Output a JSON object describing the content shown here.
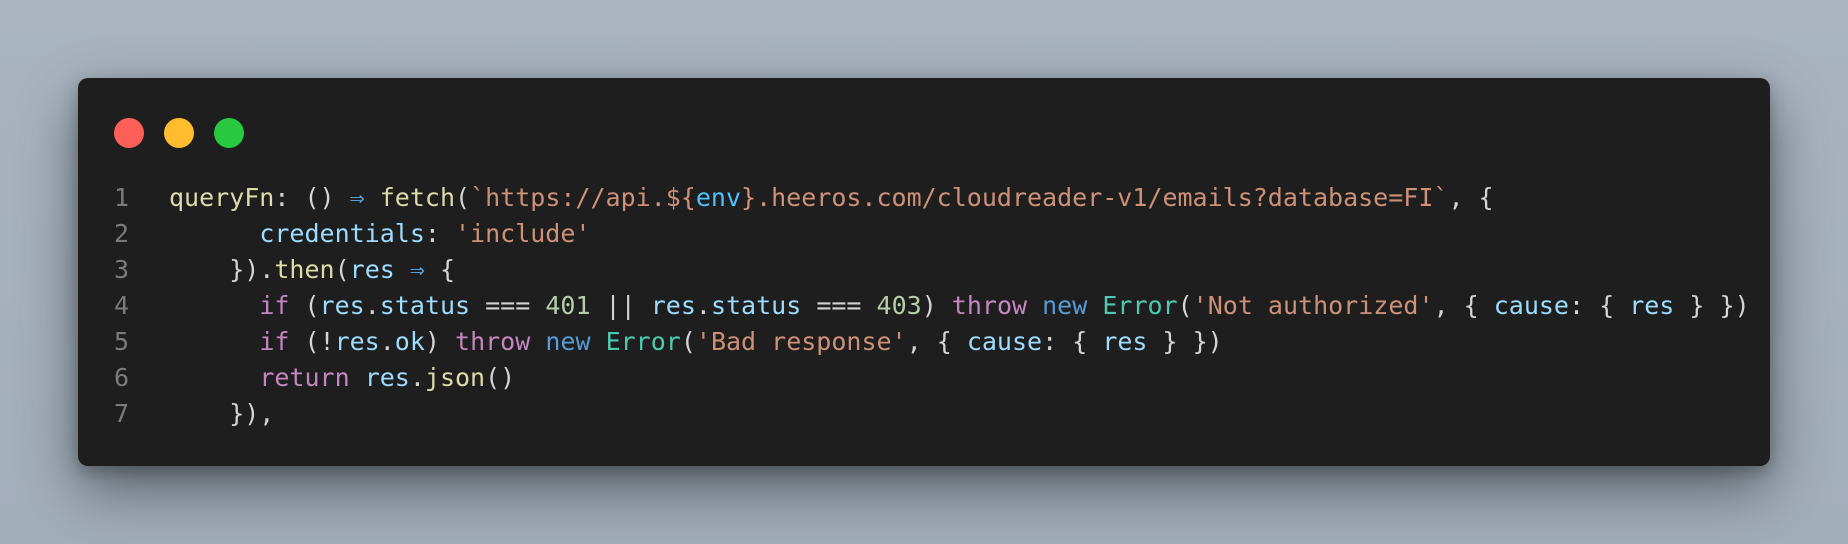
{
  "window": {
    "colors": {
      "background": "#1e1e1e",
      "close": "#ff5f57",
      "minimize": "#febc2e",
      "maximize": "#28c840"
    },
    "traffic_lights": [
      "close-button",
      "minimize-button",
      "maximize-button"
    ]
  },
  "code": {
    "language": "javascript",
    "lines": [
      {
        "number": "1",
        "tokens": [
          {
            "text": "queryFn",
            "color": "#dcdcaa"
          },
          {
            "text": ": () ",
            "color": "#d4d4d4"
          },
          {
            "text": "⇒",
            "color": "#569cd6"
          },
          {
            "text": " ",
            "color": "#d4d4d4"
          },
          {
            "text": "fetch",
            "color": "#dcdcaa"
          },
          {
            "text": "(",
            "color": "#d4d4d4"
          },
          {
            "text": "`https://api.${",
            "color": "#ce9178"
          },
          {
            "text": "env",
            "color": "#4fc1ff"
          },
          {
            "text": "}.heeros.com/cloudreader-v1/emails?database=FI`",
            "color": "#ce9178"
          },
          {
            "text": ", {",
            "color": "#d4d4d4"
          }
        ]
      },
      {
        "number": "2",
        "tokens": [
          {
            "text": "      ",
            "color": "#d4d4d4"
          },
          {
            "text": "credentials",
            "color": "#9cdcfe"
          },
          {
            "text": ": ",
            "color": "#d4d4d4"
          },
          {
            "text": "'include'",
            "color": "#ce9178"
          }
        ]
      },
      {
        "number": "3",
        "tokens": [
          {
            "text": "    }).",
            "color": "#d4d4d4"
          },
          {
            "text": "then",
            "color": "#dcdcaa"
          },
          {
            "text": "(",
            "color": "#d4d4d4"
          },
          {
            "text": "res",
            "color": "#9cdcfe"
          },
          {
            "text": " ",
            "color": "#d4d4d4"
          },
          {
            "text": "⇒",
            "color": "#569cd6"
          },
          {
            "text": " {",
            "color": "#d4d4d4"
          }
        ]
      },
      {
        "number": "4",
        "tokens": [
          {
            "text": "      ",
            "color": "#d4d4d4"
          },
          {
            "text": "if",
            "color": "#c586c0"
          },
          {
            "text": " (",
            "color": "#d4d4d4"
          },
          {
            "text": "res",
            "color": "#9cdcfe"
          },
          {
            "text": ".",
            "color": "#d4d4d4"
          },
          {
            "text": "status",
            "color": "#9cdcfe"
          },
          {
            "text": " ",
            "color": "#d4d4d4"
          },
          {
            "text": "===",
            "color": "#d4d4d4"
          },
          {
            "text": " ",
            "color": "#d4d4d4"
          },
          {
            "text": "401",
            "color": "#b5cea8"
          },
          {
            "text": " || ",
            "color": "#d4d4d4"
          },
          {
            "text": "res",
            "color": "#9cdcfe"
          },
          {
            "text": ".",
            "color": "#d4d4d4"
          },
          {
            "text": "status",
            "color": "#9cdcfe"
          },
          {
            "text": " ",
            "color": "#d4d4d4"
          },
          {
            "text": "===",
            "color": "#d4d4d4"
          },
          {
            "text": " ",
            "color": "#d4d4d4"
          },
          {
            "text": "403",
            "color": "#b5cea8"
          },
          {
            "text": ") ",
            "color": "#d4d4d4"
          },
          {
            "text": "throw",
            "color": "#c586c0"
          },
          {
            "text": " ",
            "color": "#d4d4d4"
          },
          {
            "text": "new",
            "color": "#569cd6"
          },
          {
            "text": " ",
            "color": "#d4d4d4"
          },
          {
            "text": "Error",
            "color": "#4ec9b0"
          },
          {
            "text": "(",
            "color": "#d4d4d4"
          },
          {
            "text": "'Not authorized'",
            "color": "#ce9178"
          },
          {
            "text": ", { ",
            "color": "#d4d4d4"
          },
          {
            "text": "cause",
            "color": "#9cdcfe"
          },
          {
            "text": ": { ",
            "color": "#d4d4d4"
          },
          {
            "text": "res",
            "color": "#9cdcfe"
          },
          {
            "text": " } })",
            "color": "#d4d4d4"
          }
        ]
      },
      {
        "number": "5",
        "tokens": [
          {
            "text": "      ",
            "color": "#d4d4d4"
          },
          {
            "text": "if",
            "color": "#c586c0"
          },
          {
            "text": " (!",
            "color": "#d4d4d4"
          },
          {
            "text": "res",
            "color": "#9cdcfe"
          },
          {
            "text": ".",
            "color": "#d4d4d4"
          },
          {
            "text": "ok",
            "color": "#9cdcfe"
          },
          {
            "text": ") ",
            "color": "#d4d4d4"
          },
          {
            "text": "throw",
            "color": "#c586c0"
          },
          {
            "text": " ",
            "color": "#d4d4d4"
          },
          {
            "text": "new",
            "color": "#569cd6"
          },
          {
            "text": " ",
            "color": "#d4d4d4"
          },
          {
            "text": "Error",
            "color": "#4ec9b0"
          },
          {
            "text": "(",
            "color": "#d4d4d4"
          },
          {
            "text": "'Bad response'",
            "color": "#ce9178"
          },
          {
            "text": ", { ",
            "color": "#d4d4d4"
          },
          {
            "text": "cause",
            "color": "#9cdcfe"
          },
          {
            "text": ": { ",
            "color": "#d4d4d4"
          },
          {
            "text": "res",
            "color": "#9cdcfe"
          },
          {
            "text": " } })",
            "color": "#d4d4d4"
          }
        ]
      },
      {
        "number": "6",
        "tokens": [
          {
            "text": "      ",
            "color": "#d4d4d4"
          },
          {
            "text": "return",
            "color": "#c586c0"
          },
          {
            "text": " ",
            "color": "#d4d4d4"
          },
          {
            "text": "res",
            "color": "#9cdcfe"
          },
          {
            "text": ".",
            "color": "#d4d4d4"
          },
          {
            "text": "json",
            "color": "#dcdcaa"
          },
          {
            "text": "()",
            "color": "#d4d4d4"
          }
        ]
      },
      {
        "number": "7",
        "tokens": [
          {
            "text": "    }),",
            "color": "#d4d4d4"
          }
        ]
      }
    ]
  }
}
